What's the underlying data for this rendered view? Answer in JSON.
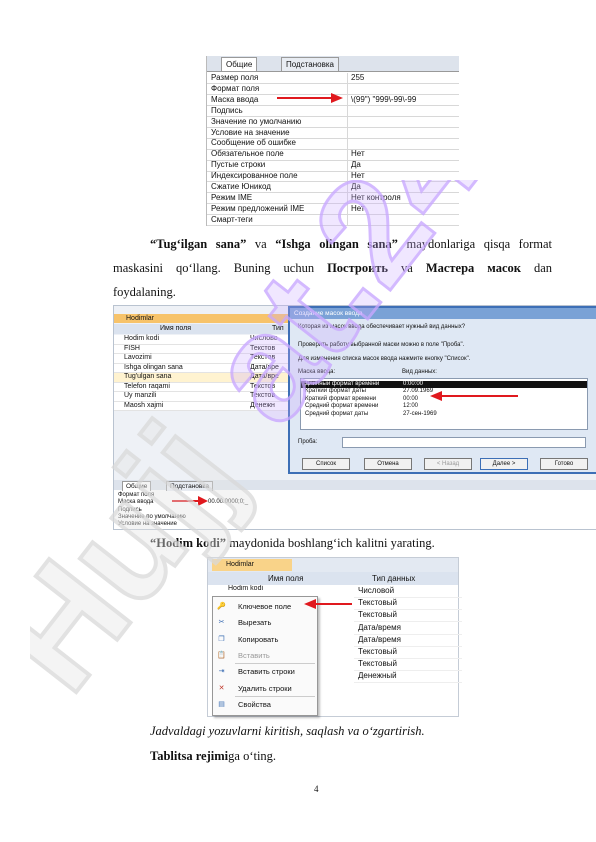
{
  "figure1": {
    "tabs": [
      "Общие",
      "Подстановка"
    ],
    "properties": [
      {
        "name": "Размер поля",
        "value": "255"
      },
      {
        "name": "Формат поля",
        "value": ""
      },
      {
        "name": "Маска ввода",
        "value": "\\(99\") \"999\\-99\\-99"
      },
      {
        "name": "Подпись",
        "value": ""
      },
      {
        "name": "Значение по умолчанию",
        "value": ""
      },
      {
        "name": "Условие на значение",
        "value": ""
      },
      {
        "name": "Сообщение об ошибке",
        "value": ""
      },
      {
        "name": "Обязательное поле",
        "value": "Нет"
      },
      {
        "name": "Пустые строки",
        "value": "Да"
      },
      {
        "name": "Индексированное поле",
        "value": "Нет"
      },
      {
        "name": "Сжатие Юникод",
        "value": "Да"
      },
      {
        "name": "Режим IME",
        "value": "Нет контроля"
      },
      {
        "name": "Режим предложений IME",
        "value": "Нет"
      },
      {
        "name": "Смарт-теги",
        "value": ""
      }
    ]
  },
  "paragraph1": {
    "q1": "“Tug‘ilgan sana”",
    "va1": "va",
    "q2": "“Ishga olingan sana”",
    "rest1": "maydonlariga qisqa format",
    "line2_a": "maskasini qo‘llang. Buning uchun",
    "postroit": "Построить",
    "va2": "va",
    "master": "Мастера масок",
    "dan": "dan",
    "line3": "foydalaning."
  },
  "figure2": {
    "table_tab": "Hodimlar",
    "col_name": "Имя поля",
    "col_type": "Тип",
    "fields": [
      {
        "name": "Hodim kodi",
        "type": "Числово"
      },
      {
        "name": "FISH",
        "type": "Текстов"
      },
      {
        "name": "Lavozimi",
        "type": "Текстов"
      },
      {
        "name": "Ishga olingan sana",
        "type": "Дата/вре"
      },
      {
        "name": "Tug'ulgan sana",
        "type": "Дата/вре"
      },
      {
        "name": "Telefon raqami",
        "type": "Текстов"
      },
      {
        "name": "Uy manzili",
        "type": "Текстов"
      },
      {
        "name": "Maosh xajmi",
        "type": "Денежн"
      }
    ],
    "dialog": {
      "title": "Создание масок ввода",
      "q": "Которая из масок ввода обеспечивает нужный вид данных?",
      "hint1": "Проверить работу выбранной маски можно в поле \"Проба\".",
      "hint2": "Для изменения списка масок ввода нажмите кнопку \"Список\".",
      "col_mask": "Маска ввода:",
      "col_view": "Вид данных:",
      "masks": [
        {
          "mask": "Длинный формат времени",
          "view": "0:00:00"
        },
        {
          "mask": "Краткий формат даты",
          "view": "27.09.1969"
        },
        {
          "mask": "Краткий формат времени",
          "view": "00:00"
        },
        {
          "mask": "Средний формат времени",
          "view": "12:00"
        },
        {
          "mask": "Средний формат даты",
          "view": "27-сен-1969"
        }
      ],
      "proba_label": "Проба:",
      "buttons": [
        "Список",
        "Отмена",
        "< Назад",
        "Далее >",
        "Готово"
      ]
    },
    "prop_tabs": [
      "Общие",
      "Подстановка"
    ],
    "props": [
      {
        "name": "Формат поля",
        "value": ""
      },
      {
        "name": "Маска ввода",
        "value": "00.00.0000;0;_"
      },
      {
        "name": "Подпись",
        "value": ""
      },
      {
        "name": "Значение по умолчанию",
        "value": ""
      },
      {
        "name": "Условие на значение",
        "value": ""
      }
    ]
  },
  "paragraph2": {
    "bold": "“Hodim kodi”",
    "rest": "maydonida boshlang‘ich kalitni yarating."
  },
  "figure3": {
    "tab": "Hodimlar",
    "col_name": "Имя поля",
    "col_type": "Тип данных",
    "first_field": "Hodim kodi",
    "types": [
      "Числовой",
      "Текстовый",
      "Текстовый",
      "Дата/время",
      "Дата/время",
      "Текстовый",
      "Текстовый",
      "Денежный"
    ],
    "menu": [
      {
        "label": "Ключевое поле",
        "icon": "key-icon",
        "disabled": false
      },
      {
        "label": "Вырезать",
        "icon": "scissors-icon",
        "disabled": false
      },
      {
        "label": "Копировать",
        "icon": "copy-icon",
        "disabled": false
      },
      {
        "label": "Вставить",
        "icon": "paste-icon",
        "disabled": true
      },
      {
        "label": "Вставить строки",
        "icon": "insert-rows-icon",
        "disabled": false
      },
      {
        "label": "Удалить строки",
        "icon": "delete-rows-icon",
        "disabled": false
      },
      {
        "label": "Свойства",
        "icon": "properties-icon",
        "disabled": false
      }
    ]
  },
  "caption": "Jadvaldagi yozuvlarni kiritish, saqlash va o‘zgartirish.",
  "paragraph3": {
    "bold": "Tablitsa rejimi",
    "rest": "ga o‘ting."
  },
  "page_number": "4",
  "watermark": "Hujjat.24",
  "colors": {
    "watermark": "#d8d8d8",
    "watermark_accent": "#c9a8ff",
    "arrow": "#e0191e"
  }
}
